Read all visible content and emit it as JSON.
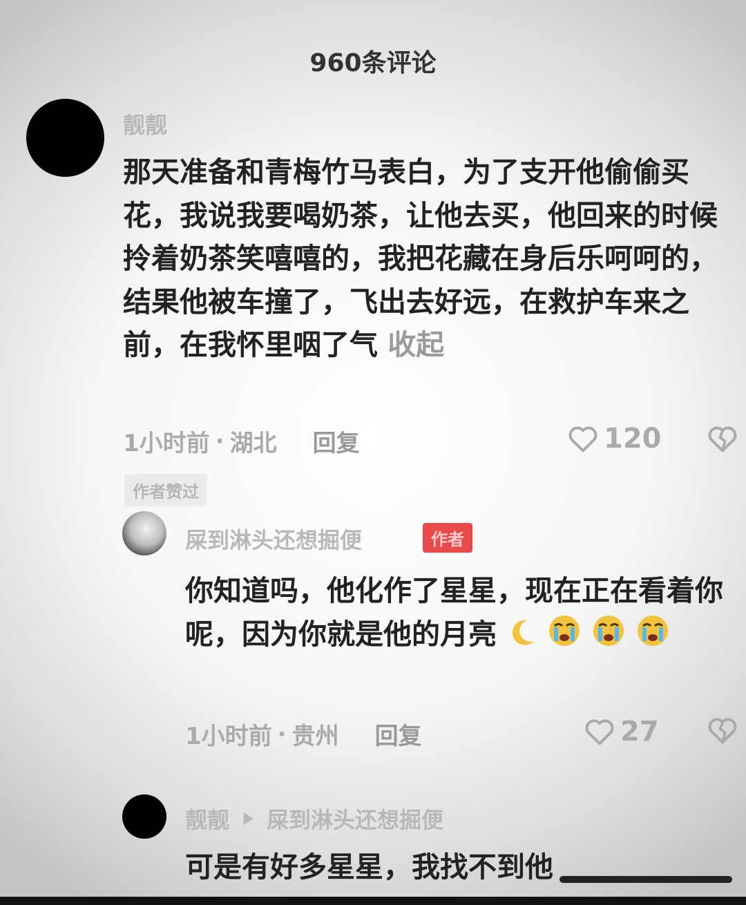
{
  "header": {
    "title": "960条评论"
  },
  "comment": {
    "username": "靓靓",
    "text": "那天准备和青梅竹马表白，为了支开他偷偷买花，我说我要喝奶茶，让他去买，他回来的时候拎着奶茶笑嘻嘻的，我把花藏在身后乐呵呵的，结果他被车撞了，飞出去好远，在救护车来之前，在我怀里咽了气",
    "collapse_label": "收起",
    "time": "1小时前",
    "location": "湖北",
    "reply_label": "回复",
    "likes": "120",
    "liked_tag": "作者赞过"
  },
  "reply1": {
    "username": "屎到淋头还想掘便",
    "badge": "作者",
    "text": "你知道吗，他化作了星星，现在正在看着你呢，因为你就是他的月亮",
    "time": "1小时前",
    "location": "贵州",
    "reply_label": "回复",
    "likes": "27"
  },
  "reply2": {
    "username": "靓靓",
    "reply_to": "屎到淋头还想掘便",
    "text": "可是有好多星星，我找不到他"
  }
}
